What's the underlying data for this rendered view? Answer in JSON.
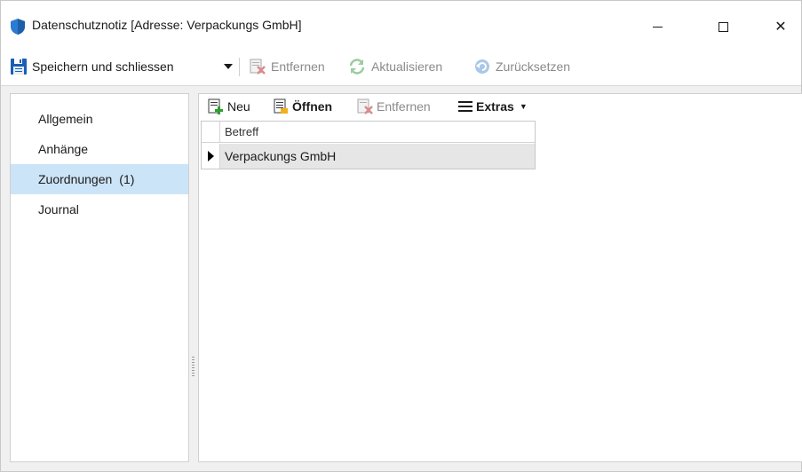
{
  "window": {
    "title": "Datenschutznotiz [Adresse: Verpackungs GmbH]",
    "icon": "shield-icon",
    "controls": [
      "minimize-icon",
      "maximize-icon",
      "close-icon"
    ],
    "close_glyph": "✕"
  },
  "toolbar": {
    "save_label": "Speichern und schliessen",
    "remove_label": "Entfernen",
    "refresh_label": "Aktualisieren",
    "reset_label": "Zurücksetzen"
  },
  "nav": {
    "items": [
      {
        "label": "Allgemein",
        "count": ""
      },
      {
        "label": "Anhänge",
        "count": ""
      },
      {
        "label": "Zuordnungen",
        "count": "(1)",
        "selected": true
      },
      {
        "label": "Journal",
        "count": ""
      }
    ]
  },
  "main": {
    "toolbar": {
      "new_label": "Neu",
      "open_label": "Öffnen",
      "remove_label": "Entfernen",
      "extras_label": "Extras"
    },
    "grid": {
      "columns": [
        "Betreff"
      ],
      "rows": [
        {
          "betreff": "Verpackungs GmbH",
          "current": true
        }
      ]
    }
  },
  "colors": {
    "selection": "#cce4f7",
    "save_icon": "#1a5fb4",
    "new_icon_plus": "#2e9e2e",
    "disabled_text": "#8a8a8a",
    "row_highlight": "#e6e6e6"
  }
}
